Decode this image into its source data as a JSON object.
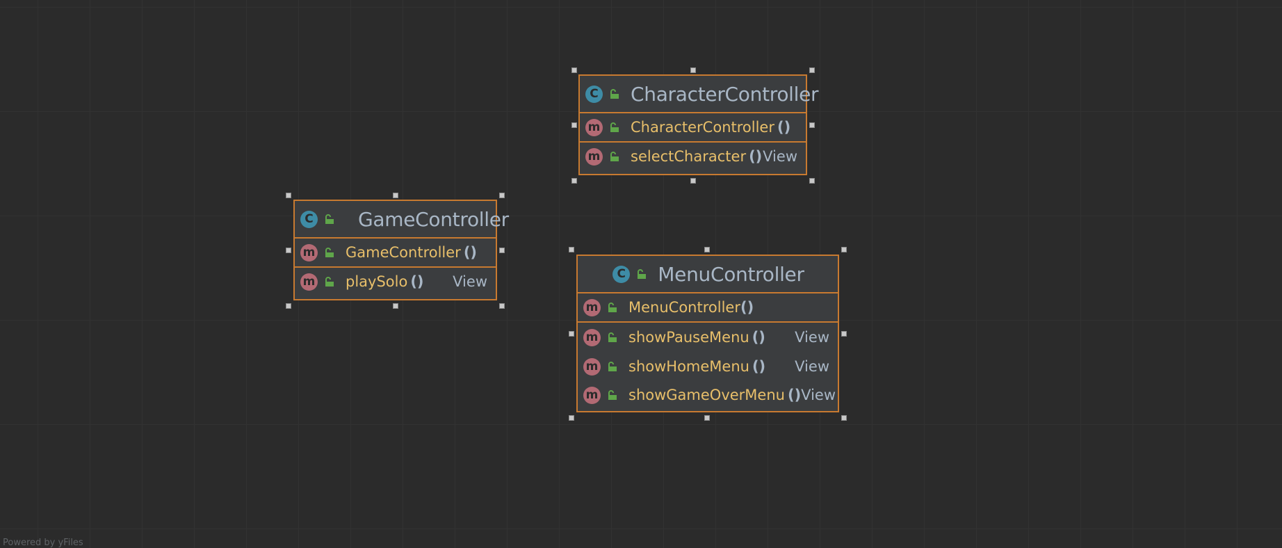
{
  "diagram": {
    "nodes": [
      {
        "id": "character-controller",
        "class_badge": "C",
        "title": "CharacterController",
        "members": [
          {
            "badge": "m",
            "name": "CharacterController",
            "parens": "()",
            "type": ""
          },
          {
            "badge": "m",
            "name": "selectCharacter",
            "parens": "()",
            "type": "View"
          }
        ]
      },
      {
        "id": "game-controller",
        "class_badge": "C",
        "title": "GameController",
        "members": [
          {
            "badge": "m",
            "name": "GameController",
            "parens": "()",
            "type": ""
          },
          {
            "badge": "m",
            "name": "playSolo",
            "parens": "()",
            "type": "View"
          }
        ]
      },
      {
        "id": "menu-controller",
        "class_badge": "C",
        "title": "MenuController",
        "members": [
          {
            "badge": "m",
            "name": "MenuController",
            "parens": "()",
            "type": ""
          },
          {
            "badge": "m",
            "name": "showPauseMenu",
            "parens": "()",
            "type": "View"
          },
          {
            "badge": "m",
            "name": "showHomeMenu",
            "parens": "()",
            "type": "View"
          },
          {
            "badge": "m",
            "name": "showGameOverMenu",
            "parens": "()",
            "type": "View"
          }
        ]
      }
    ],
    "colors": {
      "background": "#2b2b2b",
      "node_border": "#c87a30",
      "node_fill": "#3b3d3f",
      "title_text": "#a9b7c6",
      "method_text": "#e8bf6a",
      "class_badge": "#3e8ca6",
      "method_badge": "#b36a74",
      "visibility_lock": "#5fa64a"
    },
    "icons": {
      "class": "class-icon",
      "method": "method-icon",
      "visibility": "unlocked-padlock-icon"
    },
    "watermark": "Powered by yFiles"
  }
}
